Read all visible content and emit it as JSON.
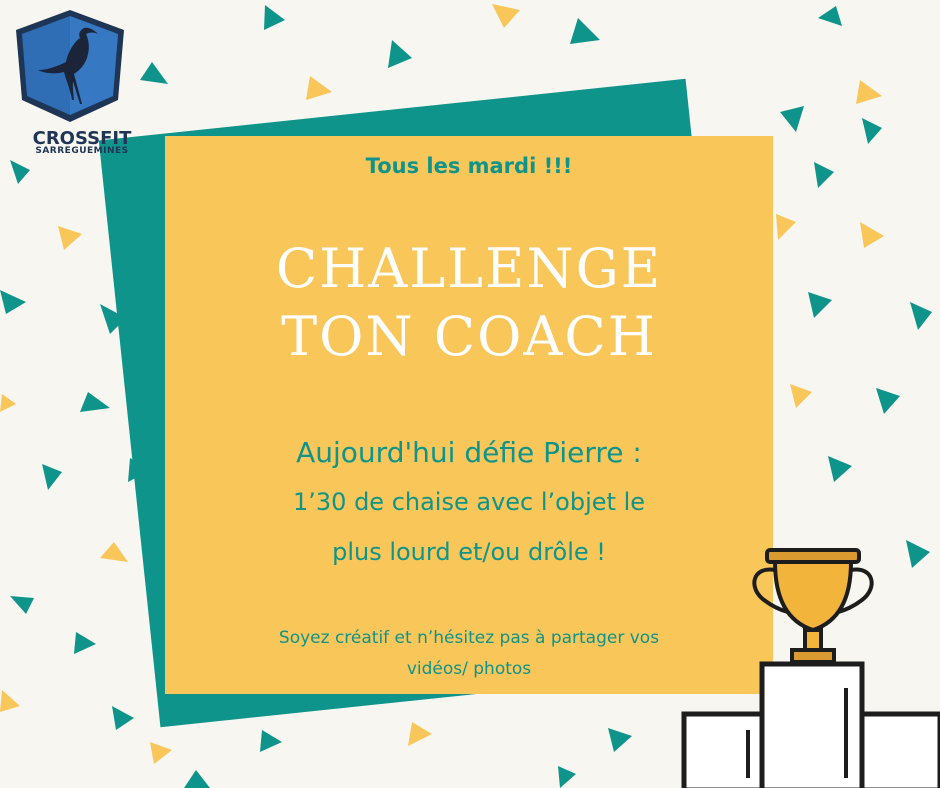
{
  "logo": {
    "name": "CROSSFIT",
    "location": "SARREGUEMINES"
  },
  "card": {
    "tagline": "Tous les mardi !!!",
    "title_line1": "CHALLENGE",
    "title_line2": "TON COACH",
    "challenge_line": "Aujourd'hui défie Pierre :",
    "description_line1": "1’30 de chaise avec l’objet le",
    "description_line2": "plus lourd et/ou drôle !",
    "note_line1": "Soyez créatif et n’hésitez pas à partager vos",
    "note_line2": "vidéos/ photos"
  },
  "colors": {
    "background": "#f8f6f0",
    "teal": "#0e948a",
    "yellow": "#f8c659",
    "title_text": "#ffffff",
    "logo_blue": "#2f6db5",
    "logo_navy": "#1f3555"
  },
  "icons": {
    "logo": "heron-shield-logo",
    "trophy": "trophy-on-podium-icon",
    "confetti": "triangle-confetti"
  }
}
